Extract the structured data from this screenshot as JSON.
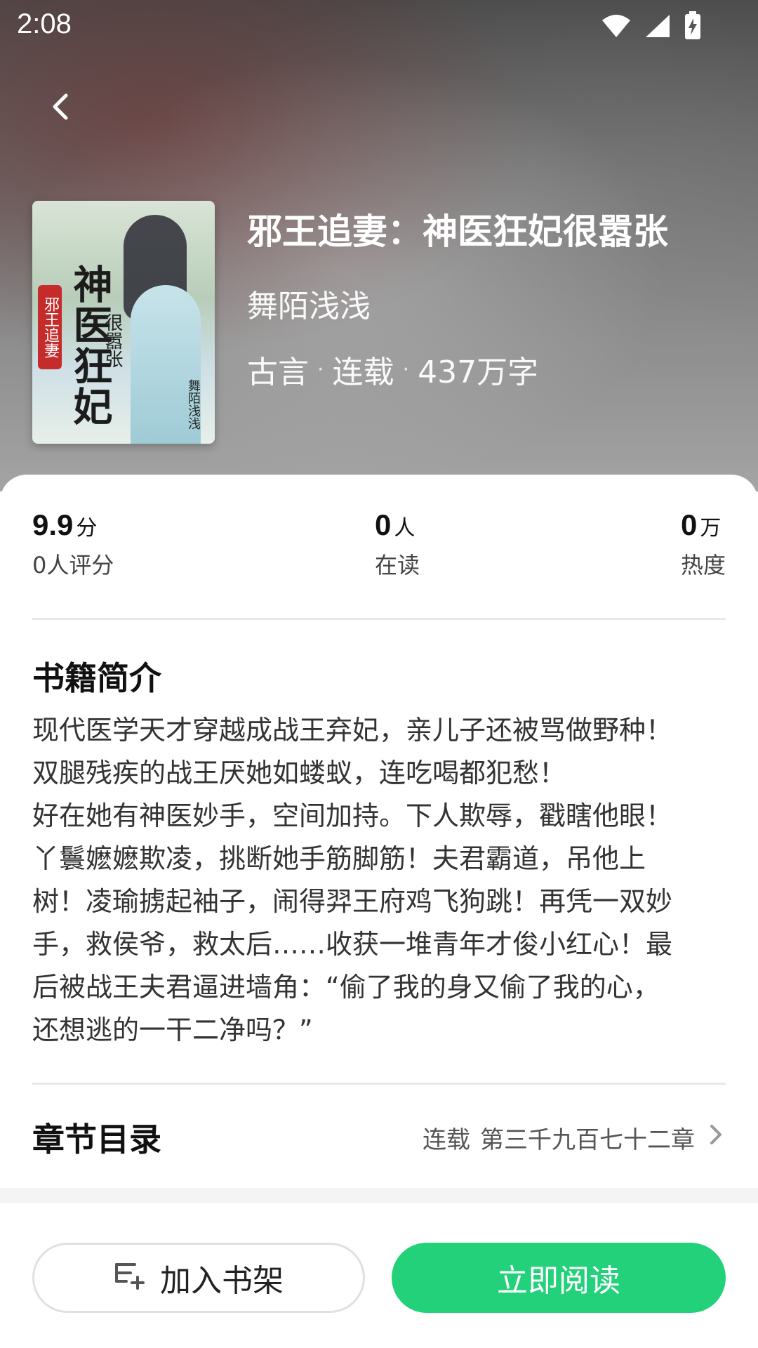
{
  "status_bar": {
    "time": "2:08",
    "icons": [
      "wifi-icon",
      "signal-icon",
      "battery-charging-icon"
    ]
  },
  "nav": {
    "back_icon": "chevron-left-icon"
  },
  "book": {
    "title": "邪王追妻：神医狂妃很嚣张",
    "author": "舞陌浅浅",
    "genre": "古言",
    "status": "连载",
    "word_count": "437万字",
    "separator": "·",
    "cover": {
      "main_title": "神医狂妃",
      "seal_text": "邪王追妻",
      "subtitle": "很嚣张",
      "author_mark": "舞陌浅浅"
    }
  },
  "stats": [
    {
      "value": "9.9",
      "unit": "分",
      "label": "0人评分"
    },
    {
      "value": "0",
      "unit": "人",
      "label": "在读"
    },
    {
      "value": "0",
      "unit": "万",
      "label": "热度"
    }
  ],
  "intro": {
    "title": "书籍简介",
    "text": "现代医学天才穿越成战王弃妃，亲儿子还被骂做野种！\n双腿残疾的战王厌她如蝼蚁，连吃喝都犯愁！\n好在她有神医妙手，空间加持。下人欺辱，戳瞎他眼！\n丫鬟嬷嬷欺凌，挑断她手筋脚筋！夫君霸道，吊他上\n树！凌瑜掳起袖子，闹得羿王府鸡飞狗跳！再凭一双妙\n手，救侯爷，救太后……收获一堆青年才俊小红心！最\n后被战王夫君逼进墙角：“偷了我的身又偷了我的心，\n还想逃的一干二净吗？”"
  },
  "toc": {
    "title": "章节目录",
    "status": "连载",
    "latest": "第三千九百七十二章",
    "arrow_icon": "chevron-right-icon"
  },
  "actions": {
    "shelf_label": "加入书架",
    "shelf_icon": "add-to-shelf-icon",
    "read_label": "立即阅读",
    "read_color": "#22d17a"
  }
}
